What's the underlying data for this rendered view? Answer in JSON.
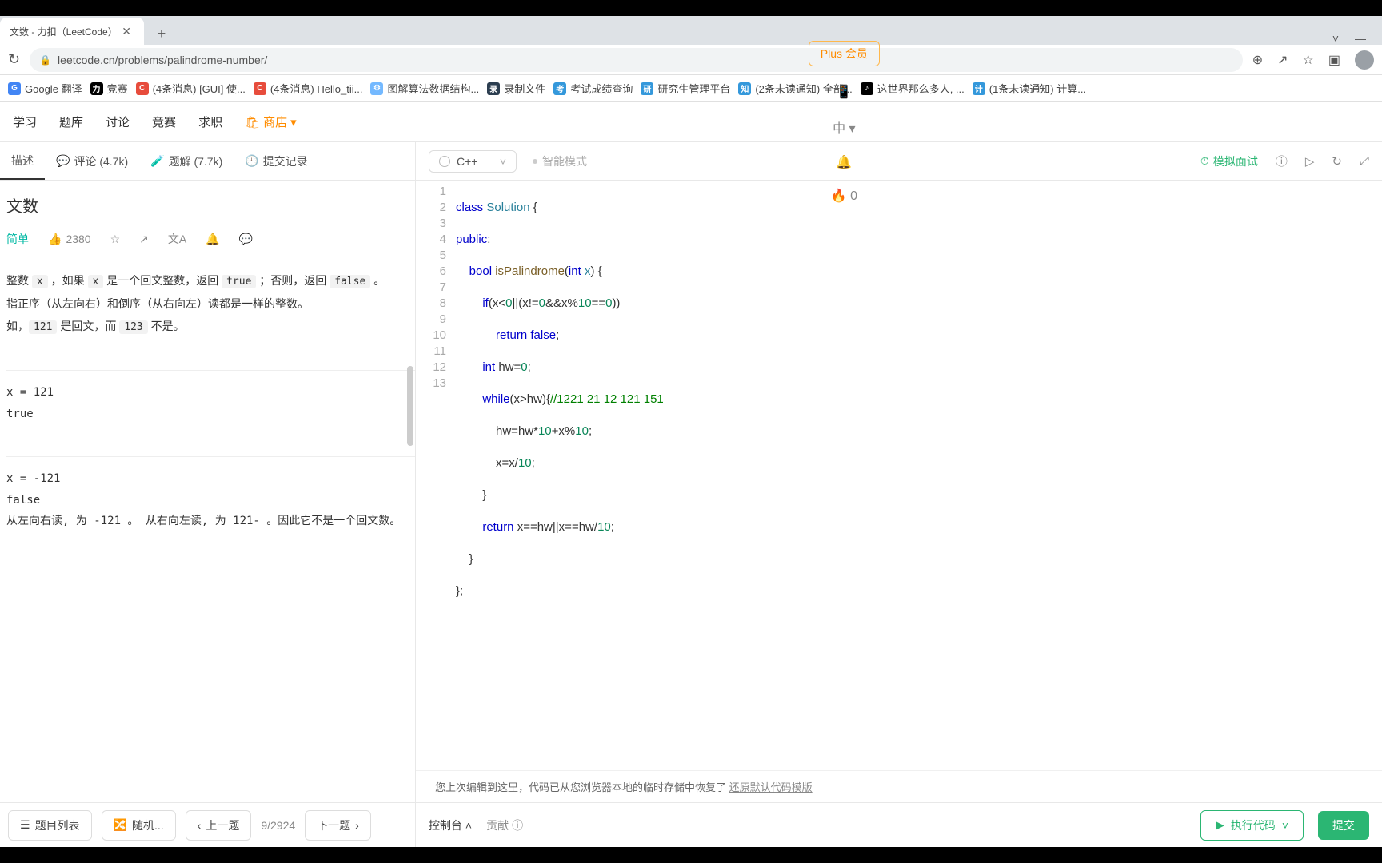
{
  "window": {
    "tab_title": "文数 - 力扣（LeetCode）",
    "new_tab": "+",
    "min": "—",
    "max": "▢",
    "close_win": "✕"
  },
  "address": {
    "url": "leetcode.cn/problems/palindrome-number/",
    "reload": "↻",
    "lock": "🔒"
  },
  "bookmarks": [
    {
      "icon": "bi-g",
      "label": "Google 翻译"
    },
    {
      "icon": "bi-l",
      "label": "竞赛"
    },
    {
      "icon": "bi-c",
      "label": "(4条消息) [GUI] 使..."
    },
    {
      "icon": "bi-c",
      "label": "(4条消息) Hello_tii..."
    },
    {
      "icon": "bi-s",
      "label": "图解算法数据结构..."
    },
    {
      "icon": "bi-v",
      "label": "录制文件"
    },
    {
      "icon": "bi-w",
      "label": "考试成绩查询"
    },
    {
      "icon": "bi-w",
      "label": "研究生管理平台"
    },
    {
      "icon": "bi-w",
      "label": "(2条未读通知) 全部..."
    },
    {
      "icon": "bi-t",
      "label": "这世界那么多人, ..."
    },
    {
      "icon": "bi-w",
      "label": "(1条未读通知) 计算..."
    }
  ],
  "nav": {
    "items": [
      "学习",
      "题库",
      "讨论",
      "竞赛",
      "求职"
    ],
    "store": "商店",
    "plus": "Plus 会员",
    "lang_switch": "中",
    "fire_count": "0"
  },
  "ltabs": {
    "desc": "描述",
    "comments": "评论 (4.7k)",
    "solutions": "题解 (7.7k)",
    "submissions": "提交记录"
  },
  "problem": {
    "title_partial": "文数",
    "likes": "2380",
    "desc_frag1": "整数 ",
    "desc_x": "x",
    "desc_frag2": " ，如果 ",
    "desc_frag3": " 是一个回文整数，返回 ",
    "desc_true": "true",
    "desc_frag4": " ；否则，返回 ",
    "desc_false": "false",
    "desc_frag5": " 。",
    "desc_line2": "指正序（从左向右）和倒序（从右向左）读都是一样的整数。",
    "desc_line3a": "如，",
    "desc_121": "121",
    "desc_line3b": " 是回文，而 ",
    "desc_123": "123",
    "desc_line3c": " 不是。",
    "ex1_in": "x = 121",
    "ex1_out": "true",
    "ex2_in": "x = -121",
    "ex2_out": "false",
    "ex2_explain": "从左向右读, 为 -121 。 从右向左读, 为 121- 。因此它不是一个回文数。"
  },
  "editor": {
    "language": "C++",
    "smart_mode": "智能模式",
    "mock_interview": "模拟面试",
    "lines": [
      "class Solution {",
      "public:",
      "    bool isPalindrome(int x) {",
      "        if(x<0||(x!=0&&x%10==0))",
      "            return false;",
      "        int hw=0;",
      "        while(x>hw){//1221 21 12 121 151",
      "            hw=hw*10+x%10;",
      "            x=x/10;",
      "        }",
      "        return x==hw||x==hw/10;",
      "    }",
      "};"
    ],
    "restore_msg": "您上次编辑到这里，代码已从您浏览器本地的临时存储中恢复了 ",
    "restore_link": "还原默认代码模版"
  },
  "bottom": {
    "prob_list": "题目列表",
    "random": "随机...",
    "prev": "上一题",
    "progress": "9/2924",
    "next": "下一题",
    "console": "控制台",
    "contrib": "贡献",
    "run": "执行代码",
    "submit": "提交"
  }
}
